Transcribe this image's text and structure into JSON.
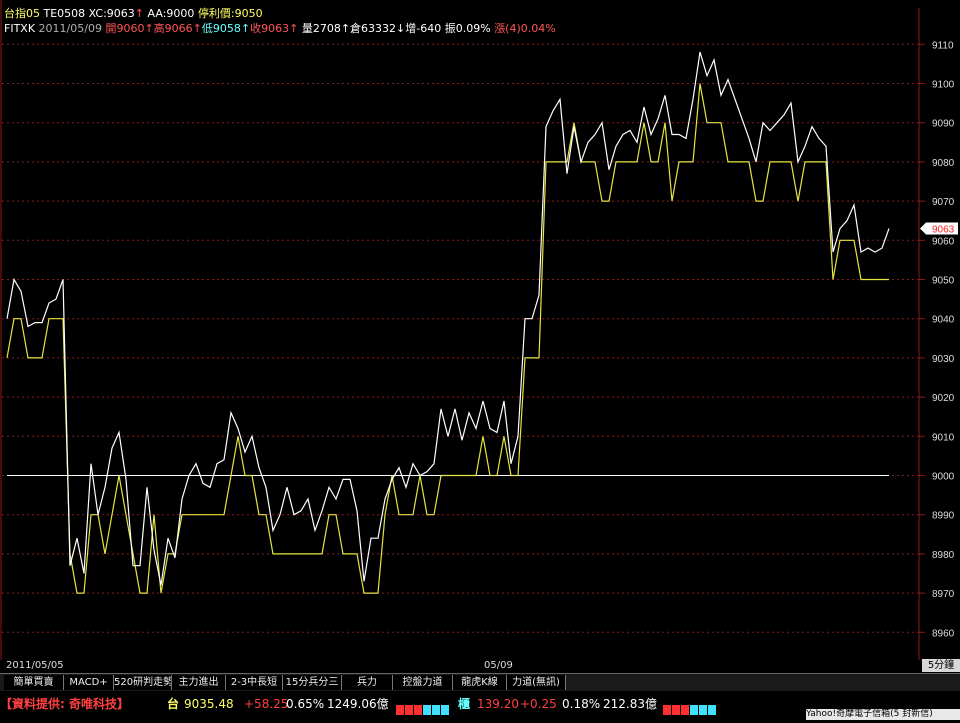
{
  "header": {
    "line1": {
      "symbol": "台指05",
      "code": "TE0508",
      "xc": "XC:9063",
      "aa": "AA:9000",
      "stop_label": "停利價",
      "stop_value": ":9050"
    },
    "line2": {
      "symbol": "FITXK",
      "date": "2011/05/09",
      "open": "開9060",
      "high": "高9066",
      "low": "低9058",
      "close": "收9063",
      "volume": "量2708",
      "oi": "倉63332",
      "oi_change": "增-640",
      "amplitude": "振0.09%",
      "rise": "漲(4)0.04%"
    }
  },
  "colors": {
    "price_line": "#ffffff",
    "avg_line": "#e6e640",
    "grid": "#8b1a1a",
    "reference": "#ffffff",
    "up": "#ff4040",
    "cyan": "#66ffff"
  },
  "chart_data": {
    "type": "line",
    "ylim": [
      8955,
      9115
    ],
    "yticks": [
      8960,
      8970,
      8980,
      8990,
      9000,
      9010,
      9020,
      9030,
      9040,
      9050,
      9060,
      9070,
      9080,
      9090,
      9100,
      9110
    ],
    "reference_level": 9000,
    "last_value_label": "9063",
    "x_labels": [
      {
        "label": "2011/05/05",
        "index": 0
      },
      {
        "label": "05/09",
        "index": 85
      }
    ],
    "series": [
      {
        "values": [
          9040,
          9050,
          9047,
          9038,
          9039,
          9039,
          9044,
          9045,
          9050,
          8977,
          8984,
          8975,
          9003,
          8990,
          8997,
          9007,
          9011,
          8999,
          8977,
          8977,
          8997,
          8981,
          8972,
          8984,
          8979,
          8994,
          9000,
          9003,
          8998,
          8997,
          9003,
          9004,
          9016,
          9012,
          9006,
          9010,
          9002,
          8997,
          8986,
          8990,
          8997,
          8990,
          8991,
          8994,
          8986,
          8991,
          8997,
          8994,
          8999,
          8999,
          8991,
          8973,
          8984,
          8984,
          8994,
          8999,
          9002,
          8997,
          9003,
          9000,
          9001,
          9003,
          9017,
          9010,
          9017,
          9009,
          9016,
          9012,
          9019,
          9012,
          9011,
          9019,
          9003,
          9010,
          9040,
          9040,
          9046,
          9089,
          9093,
          9096,
          9077,
          9089,
          9080,
          9085,
          9087,
          9090,
          9078,
          9084,
          9087,
          9088,
          9085,
          9094,
          9087,
          9091,
          9097,
          9087,
          9087,
          9086,
          9096,
          9108,
          9102,
          9106,
          9097,
          9101,
          9096,
          9091,
          9086,
          9080,
          9090,
          9088,
          9090,
          9092,
          9095,
          9080,
          9084,
          9089,
          9086,
          9084,
          9057,
          9063,
          9065,
          9069,
          9057,
          9058,
          9057,
          9058,
          9063
        ]
      },
      {
        "values": [
          9030,
          9040,
          9040,
          9030,
          9030,
          9030,
          9040,
          9040,
          9040,
          8980,
          8970,
          8970,
          8990,
          8990,
          8980,
          8990,
          9000,
          8990,
          8980,
          8970,
          8970,
          8990,
          8970,
          8980,
          8980,
          8990,
          8990,
          8990,
          8990,
          8990,
          8990,
          8990,
          9000,
          9010,
          9000,
          9000,
          8990,
          8990,
          8980,
          8980,
          8980,
          8980,
          8980,
          8980,
          8980,
          8980,
          8990,
          8990,
          8980,
          8980,
          8980,
          8970,
          8970,
          8970,
          8990,
          9000,
          8990,
          8990,
          8990,
          9000,
          8990,
          8990,
          9000,
          9000,
          9000,
          9000,
          9000,
          9000,
          9010,
          9000,
          9000,
          9010,
          9000,
          9000,
          9030,
          9030,
          9030,
          9080,
          9080,
          9080,
          9080,
          9090,
          9080,
          9080,
          9080,
          9070,
          9070,
          9080,
          9080,
          9080,
          9080,
          9090,
          9080,
          9080,
          9090,
          9070,
          9080,
          9080,
          9080,
          9100,
          9090,
          9090,
          9090,
          9080,
          9080,
          9080,
          9080,
          9070,
          9070,
          9080,
          9080,
          9080,
          9080,
          9070,
          9080,
          9080,
          9080,
          9080,
          9050,
          9060,
          9060,
          9060,
          9050,
          9050,
          9050,
          9050,
          9050
        ]
      }
    ]
  },
  "datebar": {
    "start": "2011/05/05",
    "mid": "05/09",
    "timeframe": "5分鐘"
  },
  "tabs": [
    "簡單買賣",
    "MACD+",
    "520研判走勢",
    "主力進出",
    "2-3中長短",
    "15分兵分三",
    "兵力",
    "控盤力道",
    "龍虎K線",
    "力道(無訊)"
  ],
  "ticker": {
    "provider": "【資料提供: 奇唯科技】",
    "tw_label": "台",
    "tw_value": "9035.48",
    "tw_change": "+58.25",
    "tw_pct": "0.65%",
    "tw_volume": "1249.06億",
    "otc_label": "櫃",
    "otc_value": "139.20",
    "otc_change": "+0.25",
    "otc_pct": "0.18%",
    "otc_volume": "212.83億",
    "mail": "Yahoo!奇摩電子信箱(5 封新信)"
  }
}
